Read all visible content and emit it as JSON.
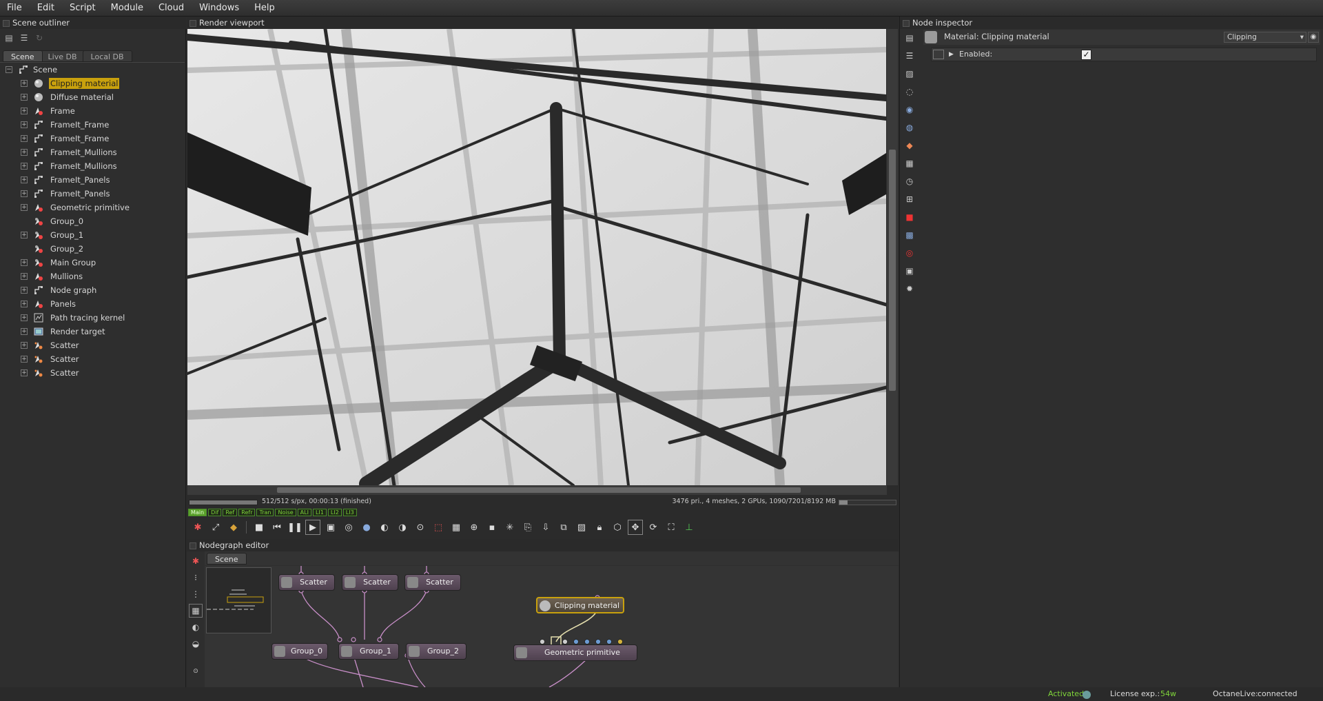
{
  "menu": [
    "File",
    "Edit",
    "Script",
    "Module",
    "Cloud",
    "Windows",
    "Help"
  ],
  "outliner": {
    "title": "Scene outliner",
    "tabs": [
      "Scene",
      "Live DB",
      "Local DB"
    ],
    "root": "Scene",
    "items": [
      {
        "label": "Clipping material",
        "icon": "material-icon",
        "expand": true,
        "selected": true
      },
      {
        "label": "Diffuse material",
        "icon": "material-icon",
        "expand": true
      },
      {
        "label": "Frame",
        "icon": "geometry-icon",
        "expand": true
      },
      {
        "label": "FrameIt_Frame",
        "icon": "node-graph-icon",
        "expand": true
      },
      {
        "label": "FrameIt_Frame",
        "icon": "node-graph-icon",
        "expand": true
      },
      {
        "label": "FrameIt_Mullions",
        "icon": "node-graph-icon",
        "expand": true
      },
      {
        "label": "FrameIt_Mullions",
        "icon": "node-graph-icon",
        "expand": true
      },
      {
        "label": "FrameIt_Panels",
        "icon": "node-graph-icon",
        "expand": true
      },
      {
        "label": "FrameIt_Panels",
        "icon": "node-graph-icon",
        "expand": true
      },
      {
        "label": "Geometric primitive",
        "icon": "geometry-icon",
        "expand": true
      },
      {
        "label": "Group_0",
        "icon": "group-icon",
        "expand": false
      },
      {
        "label": "Group_1",
        "icon": "group-icon",
        "expand": true
      },
      {
        "label": "Group_2",
        "icon": "group-icon",
        "expand": false
      },
      {
        "label": "Main Group",
        "icon": "group-icon",
        "expand": true
      },
      {
        "label": "Mullions",
        "icon": "geometry-icon",
        "expand": true
      },
      {
        "label": "Node graph",
        "icon": "node-graph-icon",
        "expand": true
      },
      {
        "label": "Panels",
        "icon": "geometry-icon",
        "expand": true
      },
      {
        "label": "Path tracing kernel",
        "icon": "kernel-icon",
        "expand": true
      },
      {
        "label": "Render target",
        "icon": "render-target-icon",
        "expand": true
      },
      {
        "label": "Scatter",
        "icon": "scatter-icon",
        "expand": true
      },
      {
        "label": "Scatter",
        "icon": "scatter-icon",
        "expand": true
      },
      {
        "label": "Scatter",
        "icon": "scatter-icon",
        "expand": true
      }
    ]
  },
  "viewport": {
    "title": "Render viewport",
    "status_left": "512/512 s/px, 00:00:13 (finished)",
    "status_right": "3476 pri., 4 meshes, 2 GPUs, 1090/7201/8192 MB",
    "passes": [
      "Main",
      "Dif",
      "Ref",
      "Refr",
      "Tran",
      "Noise",
      "ALI",
      "LI1",
      "LI2",
      "LI3"
    ],
    "progress": 1.0,
    "memory_fraction": 0.15
  },
  "nodegraph": {
    "title": "Nodegraph editor",
    "tab": "Scene",
    "nodes": {
      "scatter1": "Scatter",
      "scatter2": "Scatter",
      "scatter3": "Scatter",
      "group0": "Group_0",
      "group1": "Group_1",
      "group2": "Group_2",
      "clip": "Clipping material",
      "geo": "Geometric primitive"
    }
  },
  "inspector": {
    "title": "Node inspector",
    "header": "Material: Clipping material",
    "dropdown": "Clipping",
    "row_label": "Enabled:",
    "enabled": true,
    "check_glyph": "✓"
  },
  "footer": {
    "activated": "Activated",
    "license_label": "License exp.:",
    "license_value": "54w",
    "live_label": "OctaneLive:",
    "live_value": "connected",
    "license_color": "#7fd43a"
  },
  "colors": {
    "selection": "#c9a10d",
    "accent_green": "#7fd43a"
  }
}
